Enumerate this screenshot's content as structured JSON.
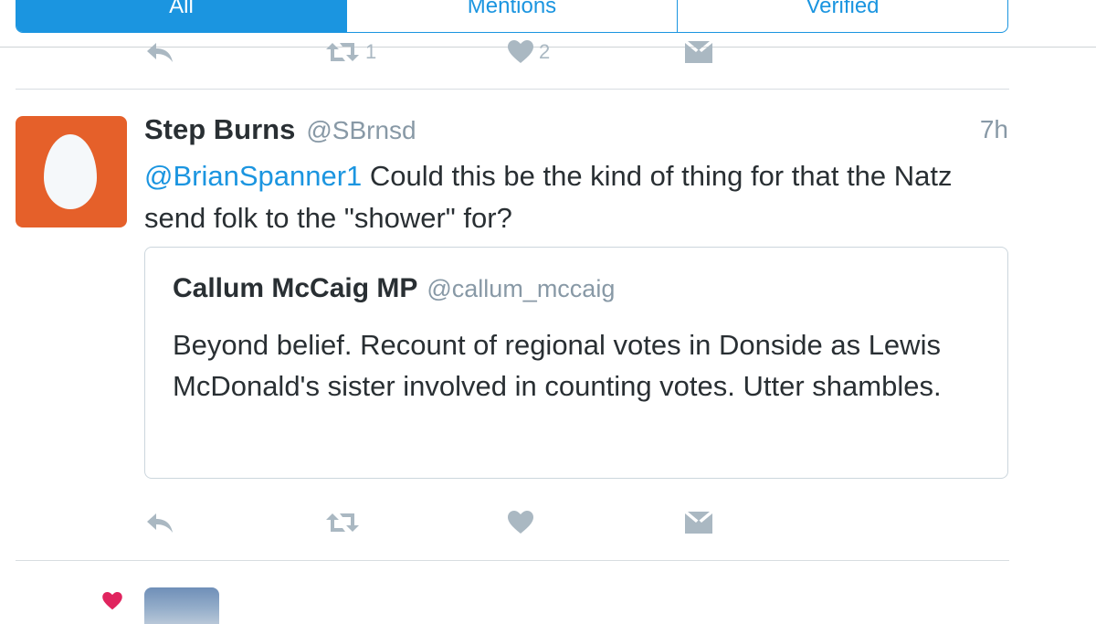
{
  "filter_tabs": [
    {
      "label": "All",
      "active": true
    },
    {
      "label": "Mentions",
      "active": false
    },
    {
      "label": "Verified",
      "active": false
    }
  ],
  "previous_tweet": {
    "retweet_count": "1",
    "like_count": "2"
  },
  "tweet": {
    "name": "Step Burns",
    "handle": "@SBrnsd",
    "time": "7h",
    "mention": "@BrianSpanner1",
    "text": " Could this be the kind of thing for that the Natz send folk to the \"shower\" for?",
    "avatar_color": "#e5602a",
    "quoted": {
      "name": "Callum McCaig MP",
      "handle": "@callum_mccaig",
      "text": "Beyond belief. Recount of regional votes in Donside as Lewis McDonald's sister involved in counting votes. Utter shambles."
    },
    "actions": [
      "reply-icon",
      "retweet-icon",
      "like-icon",
      "direct-message-icon"
    ]
  },
  "next_item": {
    "indicator_icon": "heart-icon",
    "indicator_color": "#e0245e"
  },
  "colors": {
    "accent": "#1b95e0",
    "muted": "#8899a6",
    "icon_gray": "#aab8c2",
    "text": "#292f33"
  }
}
